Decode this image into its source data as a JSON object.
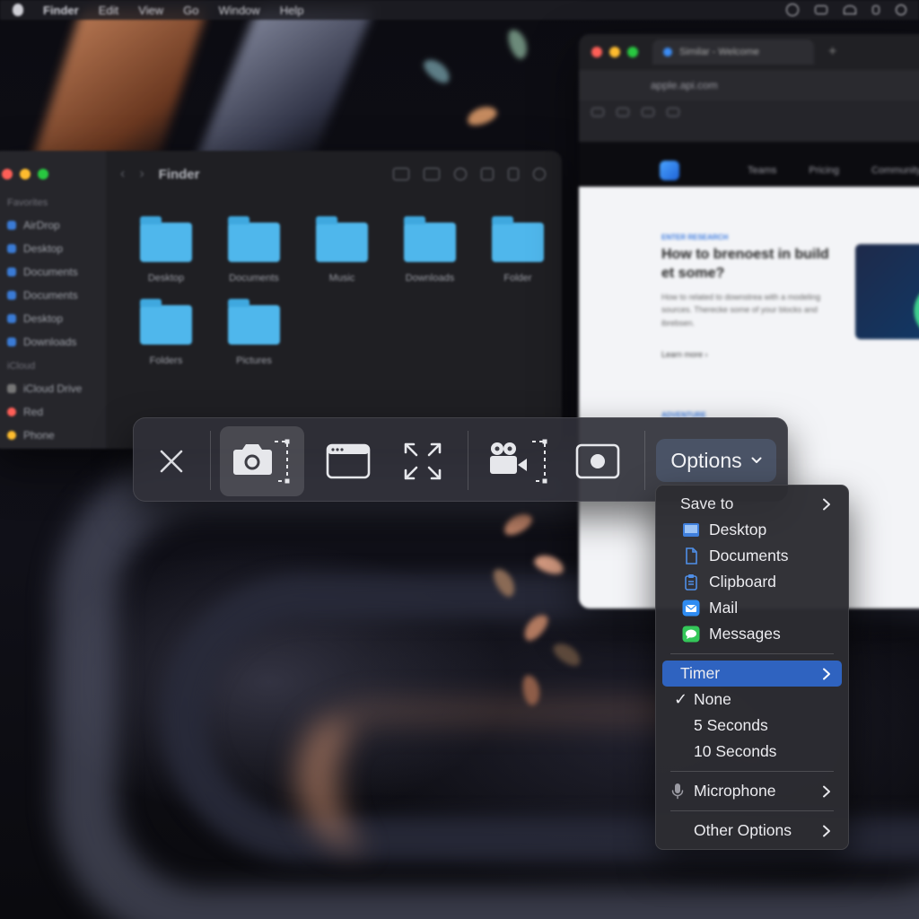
{
  "menubar": {
    "app": "Finder",
    "items": [
      "Edit",
      "View",
      "Go",
      "Window",
      "Help"
    ]
  },
  "finder": {
    "title": "Finder",
    "sidebar_sections": [
      {
        "heading": "Favorites",
        "items": [
          "AirDrop",
          "Desktop",
          "Documents",
          "Documents",
          "Desktop",
          "Downloads"
        ]
      },
      {
        "heading": "iCloud",
        "items": [
          "iCloud Drive",
          "Red",
          "Phone"
        ]
      }
    ],
    "folders": [
      "Desktop",
      "Documents",
      "Music",
      "Downloads",
      "Folder",
      "Folders",
      "Pictures"
    ]
  },
  "browser": {
    "tab_title": "Similar - Welcome",
    "url": "apple.api.com",
    "nav": [
      "Teams",
      "Pricing",
      "Community"
    ],
    "hero": {
      "kicker": "ENTER RESEARCH",
      "title": "How to brenoest in build et some?",
      "text": "How to related to downstrea with a modeling sources. Therecke some of your blocks and ibrebsen.",
      "link": "Learn more ›",
      "kicker2": "ADVENTURE"
    }
  },
  "toolbar": {
    "options_label": "Options",
    "tools": [
      {
        "name": "close",
        "icon": "close-icon"
      },
      {
        "name": "capture-selected-portion",
        "icon": "camera-selection-icon",
        "active": true
      },
      {
        "name": "capture-window",
        "icon": "window-icon"
      },
      {
        "name": "capture-entire-screen",
        "icon": "fullscreen-arrows-icon"
      },
      {
        "name": "record-selected-portion",
        "icon": "video-camera-selection-icon"
      },
      {
        "name": "record-entire-screen",
        "icon": "record-screen-icon"
      }
    ]
  },
  "options_menu": {
    "save_to": {
      "label": "Save to",
      "items": [
        {
          "label": "Desktop",
          "icon": "desktop-icon"
        },
        {
          "label": "Documents",
          "icon": "document-icon"
        },
        {
          "label": "Clipboard",
          "icon": "clipboard-icon"
        },
        {
          "label": "Mail",
          "icon": "mail-icon"
        },
        {
          "label": "Messages",
          "icon": "messages-icon"
        }
      ]
    },
    "timer": {
      "label": "Timer",
      "options": [
        "None",
        "5 Seconds",
        "10 Seconds"
      ],
      "selected": "None"
    },
    "microphone": {
      "label": "Microphone",
      "icon": "microphone-icon"
    },
    "other": {
      "label": "Other Options"
    }
  },
  "colors": {
    "accent": "#2f63c0",
    "options_button": "#4a5366",
    "folder": "#4fb7ec"
  }
}
